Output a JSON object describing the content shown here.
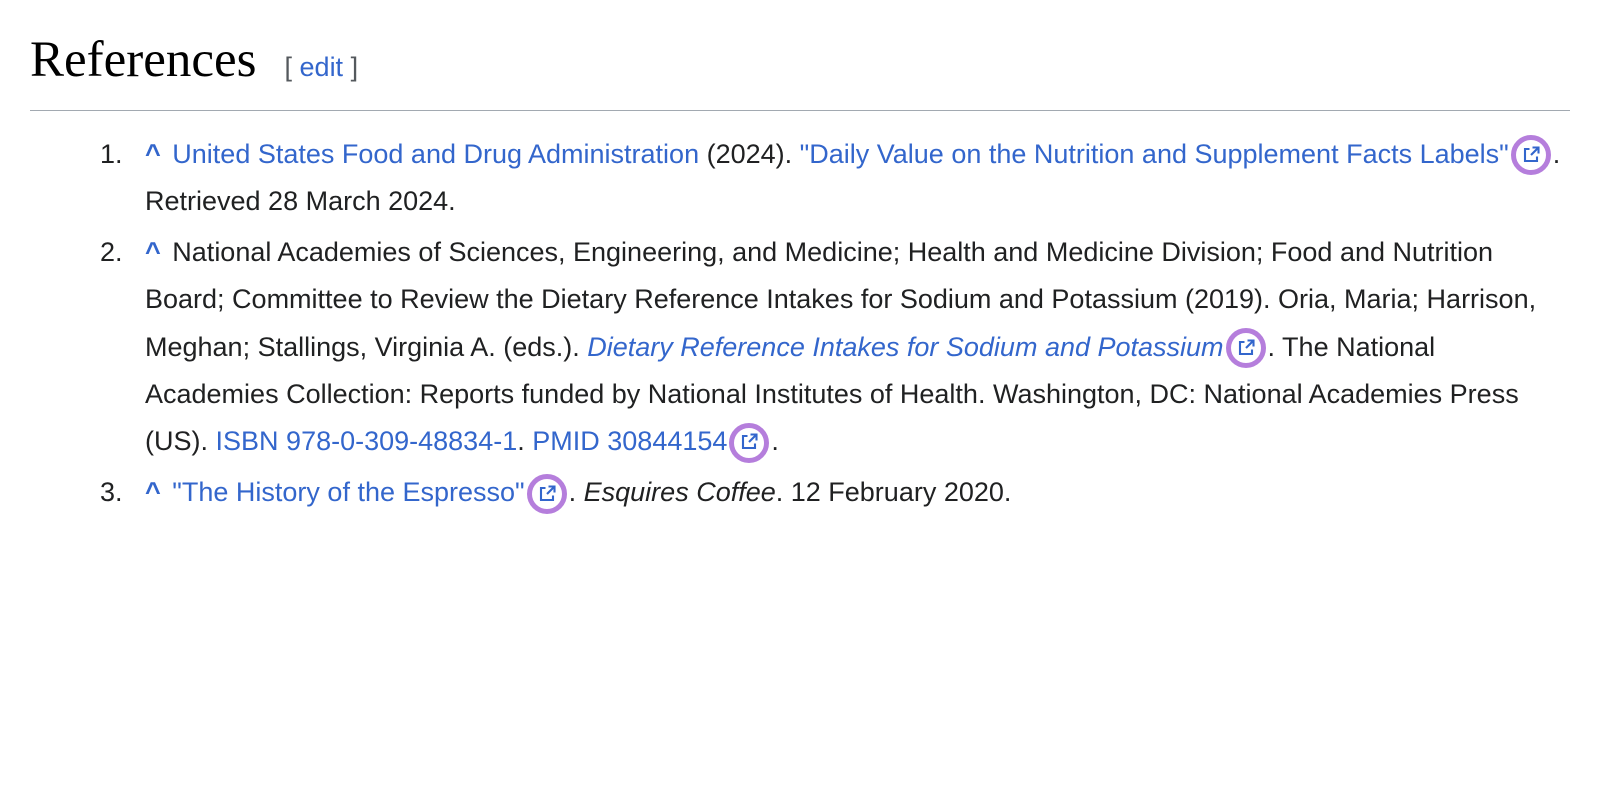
{
  "section": {
    "heading": "References",
    "edit_label": "edit"
  },
  "references": [
    {
      "num": "1",
      "author_link": "United States Food and Drug Administration",
      "year_paren": " (2024). ",
      "title_quote_open": "\"",
      "title_link": "Daily Value on the Nutrition and Supplement Facts Labels",
      "title_quote_close": "\"",
      "retrieved": ". Retrieved 28 March 2024."
    },
    {
      "num": "2",
      "authors_plain": "National Academies of Sciences, Engineering, and Medicine; Health and Medicine Division; Food and Nutrition Board; Committee to Review the Dietary Reference Intakes for Sodium and Potassium (2019). Oria, Maria; Harrison, Meghan; Stallings, Virginia A. (eds.). ",
      "title_link": "Dietary Reference Intakes for Sodium and Potassium",
      "post_title": ". The National Academies Collection: Reports funded by National Institutes of Health. Washington, DC: National Academies Press (US). ",
      "isbn_label": "ISBN",
      "isbn_value": "978-0-309-48834-1",
      "pmid_label": "PMID",
      "pmid_value": "30844154",
      "period": "."
    },
    {
      "num": "3",
      "title_quote_open": "\"",
      "title_link": "The History of the Espresso",
      "title_quote_close": "\"",
      "source_italic": "Esquires Coffee",
      "date_text": ". 12 February 2020.",
      "sep": ". "
    }
  ]
}
